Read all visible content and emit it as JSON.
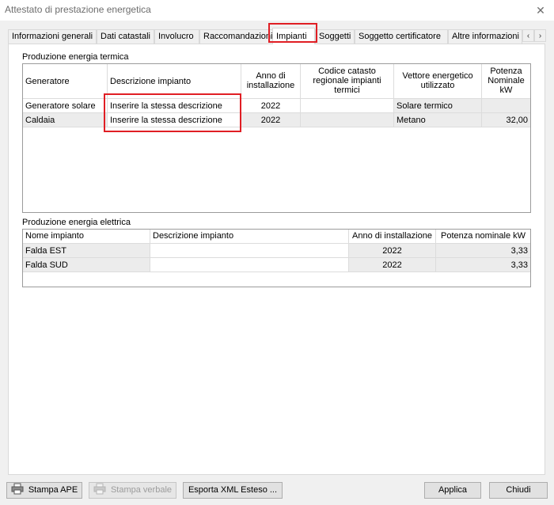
{
  "window": {
    "title": "Attestato di prestazione energetica",
    "close_glyph": "✕"
  },
  "tabs": [
    {
      "label": "Informazioni generali",
      "active": false
    },
    {
      "label": "Dati catastali",
      "active": false
    },
    {
      "label": "Involucro",
      "active": false
    },
    {
      "label": "Raccomandazioni",
      "active": false
    },
    {
      "label": "Impianti",
      "active": true
    },
    {
      "label": "Soggetti",
      "active": false
    },
    {
      "label": "Soggetto certificatore",
      "active": false
    },
    {
      "label": "Altre informazioni",
      "active": false
    }
  ],
  "tab_scroll": {
    "left": "‹",
    "right": "›"
  },
  "thermal": {
    "group_label": "Produzione energia termica",
    "columns": {
      "generatore": "Generatore",
      "descrizione": "Descrizione impianto",
      "anno": "Anno di installazione",
      "codice": "Codice catasto regionale impianti termici",
      "vettore": "Vettore energetico utilizzato",
      "potenza": "Potenza Nominale kW"
    },
    "rows": [
      {
        "generatore": "Generatore solare",
        "descrizione": "Inserire la stessa descrizione",
        "anno": "2022",
        "codice": "",
        "vettore": "Solare termico",
        "potenza": ""
      },
      {
        "generatore": "Caldaia",
        "descrizione": "Inserire la stessa descrizione",
        "anno": "2022",
        "codice": "",
        "vettore": "Metano",
        "potenza": "32,00"
      }
    ]
  },
  "electric": {
    "group_label": "Produzione energia elettrica",
    "columns": {
      "nome": "Nome impianto",
      "descrizione": "Descrizione impianto",
      "anno": "Anno di installazione",
      "potenza": "Potenza nominale kW"
    },
    "rows": [
      {
        "nome": "Falda EST",
        "descrizione": "",
        "anno": "2022",
        "potenza": "3,33"
      },
      {
        "nome": "Falda SUD",
        "descrizione": "",
        "anno": "2022",
        "potenza": "3,33"
      }
    ]
  },
  "buttons": {
    "stampa_ape": "Stampa APE",
    "stampa_verbale": "Stampa verbale",
    "esporta_xml": "Esporta XML Esteso ...",
    "applica": "Applica",
    "chiudi": "Chiudi"
  },
  "icons": {
    "printer": "printer-icon",
    "close": "close-icon"
  },
  "colors": {
    "highlight": "#e01e24",
    "grid_border": "#9b9b9b",
    "row_gray": "#ececec"
  }
}
